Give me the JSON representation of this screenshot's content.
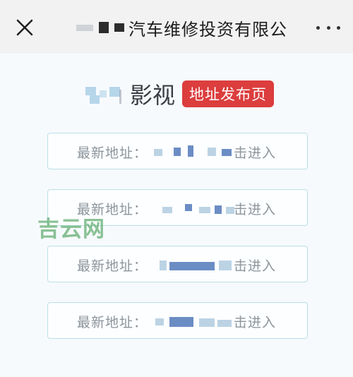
{
  "topbar": {
    "title_visible": "汽车维修投资有限公"
  },
  "site": {
    "name_visible": "影视",
    "publish_badge": "地址发布页"
  },
  "addresses": [
    {
      "label": "最新地址：",
      "action": "击进入"
    },
    {
      "label": "最新地址：",
      "action": "击进入"
    },
    {
      "label": "最新地址：",
      "action": "击进入"
    },
    {
      "label": "最新地址：",
      "action": "击进入"
    }
  ],
  "watermark": "吉云网",
  "colors": {
    "badge": "#dc3d3d",
    "button_border": "#b9dfe8",
    "watermark": "#5aaa68"
  },
  "icons": {
    "close": "close-icon",
    "more": "more-horizontal-icon"
  }
}
